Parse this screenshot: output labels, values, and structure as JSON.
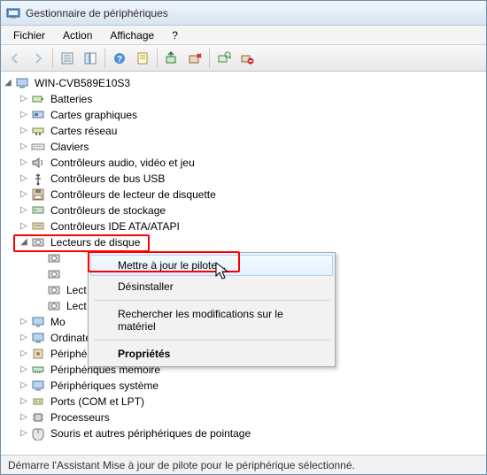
{
  "window": {
    "title": "Gestionnaire de périphériques"
  },
  "menu": {
    "file": "Fichier",
    "action": "Action",
    "view": "Affichage",
    "help": "?"
  },
  "tree": {
    "root": "WIN-CVB589E10S3",
    "cat_batteries": "Batteries",
    "cat_display": "Cartes graphiques",
    "cat_network": "Cartes réseau",
    "cat_keyboards": "Claviers",
    "cat_sound": "Contrôleurs audio, vidéo et jeu",
    "cat_usb": "Contrôleurs de bus USB",
    "cat_floppy": "Contrôleurs de lecteur de disquette",
    "cat_storage": "Contrôleurs de stockage",
    "cat_ide": "Contrôleurs IDE ATA/ATAPI",
    "cat_disks": "Lecteurs de disque",
    "cat_disk_child1": "",
    "cat_disk_child2": "",
    "cat_disk_child3": "Lect",
    "cat_disk_child4": "Lect",
    "cat_monitors": "Mo",
    "cat_computer": "Ordinateur",
    "cat_hid": "Périphériques d'interface utilisateur",
    "cat_memory": "Périphériques mémoire",
    "cat_system": "Périphériques système",
    "cat_ports": "Ports (COM et LPT)",
    "cat_cpu": "Processeurs",
    "cat_mice": "Souris et autres périphériques de pointage"
  },
  "context_menu": {
    "update": "Mettre à jour le pilote...",
    "uninstall": "Désinstaller",
    "scan": "Rechercher les modifications sur le matériel",
    "props": "Propriétés"
  },
  "status": {
    "text": "Démarre l'Assistant Mise à jour de pilote pour le périphérique sélectionné."
  }
}
